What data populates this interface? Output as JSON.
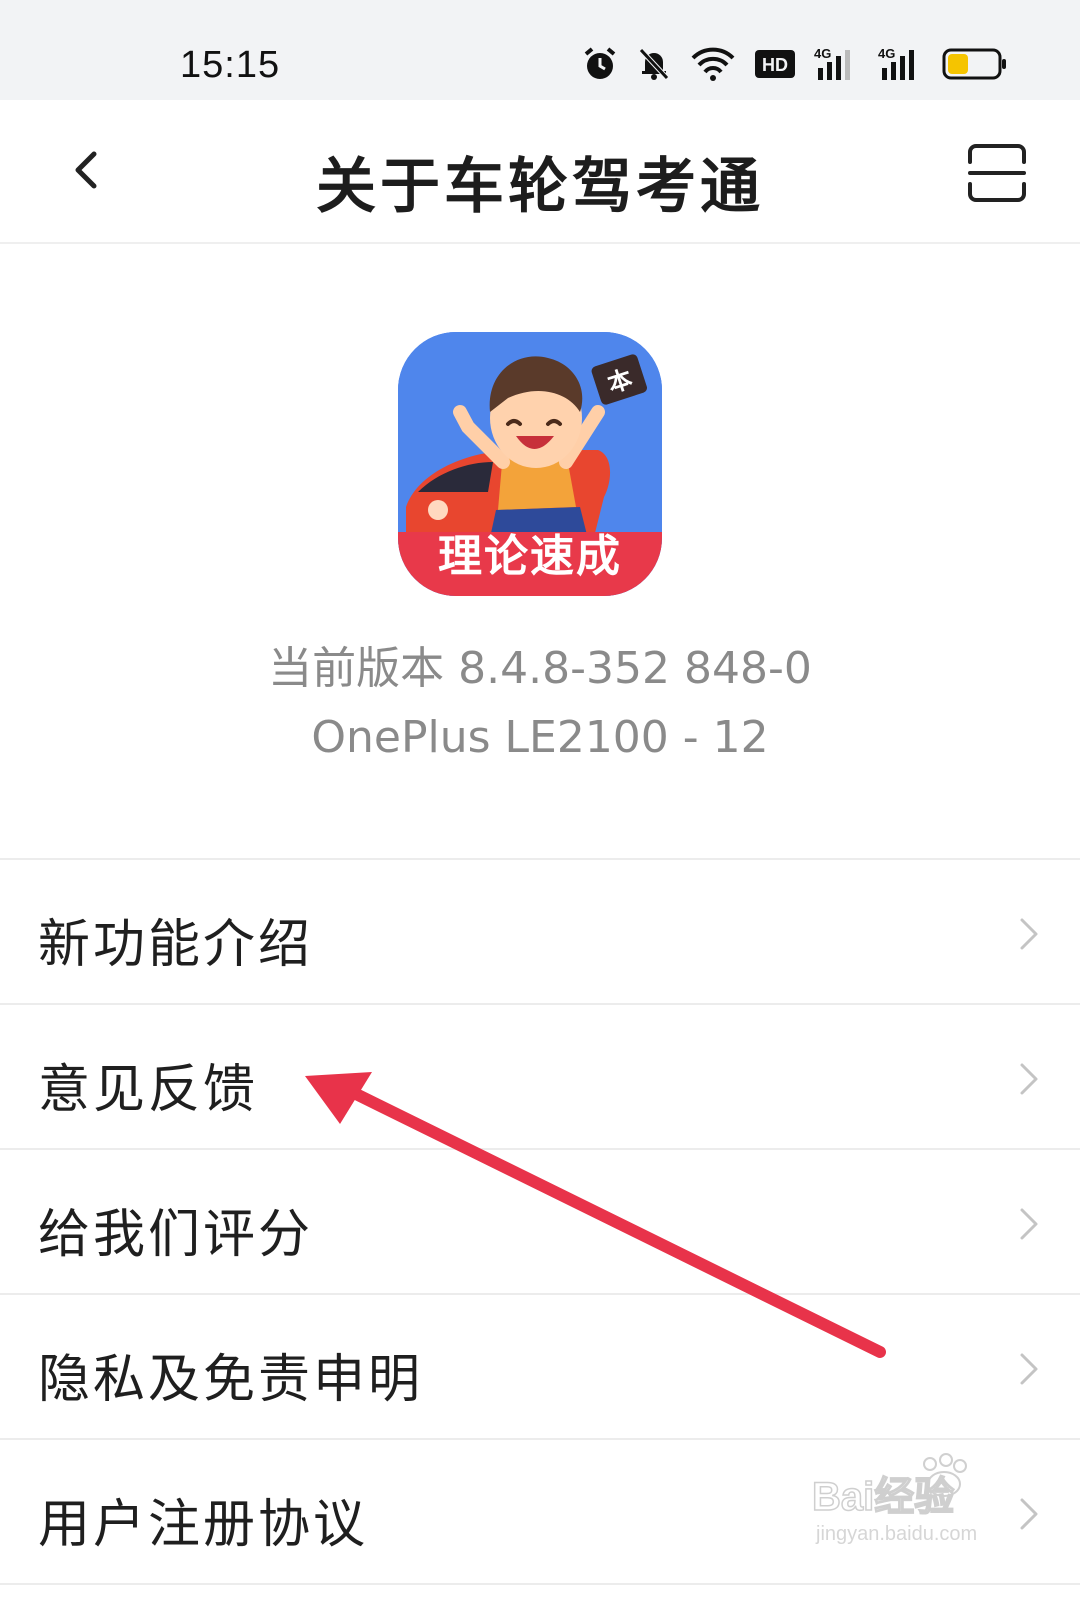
{
  "status_bar": {
    "time": "15:15",
    "icons": [
      "alarm-icon",
      "mute-icon",
      "wifi-icon",
      "hd-icon",
      "signal-4g-icon",
      "signal-4g-icon",
      "battery-icon"
    ],
    "hd_label": "HD",
    "network_label": "4G",
    "battery_color": "#f5c400"
  },
  "nav": {
    "title": "关于车轮驾考通",
    "back_icon": "chevron-left-icon",
    "action_icon": "scan-icon"
  },
  "app": {
    "badge_text": "理论速成",
    "card_text": "本",
    "version": "当前版本 8.4.8-352 848-0",
    "device": "OnePlus LE2100 - 12"
  },
  "menu": {
    "items": [
      {
        "label": "新功能介绍"
      },
      {
        "label": "意见反馈"
      },
      {
        "label": "给我们评分"
      },
      {
        "label": "隐私及免责申明"
      },
      {
        "label": "用户注册协议"
      }
    ]
  },
  "colors": {
    "annotation_arrow": "#e8334a",
    "icon_blue": "#4f86ec",
    "badge_red": "#e8394a"
  },
  "watermark": {
    "brand": "Bai经验",
    "url": "jingyan.baidu.com"
  }
}
